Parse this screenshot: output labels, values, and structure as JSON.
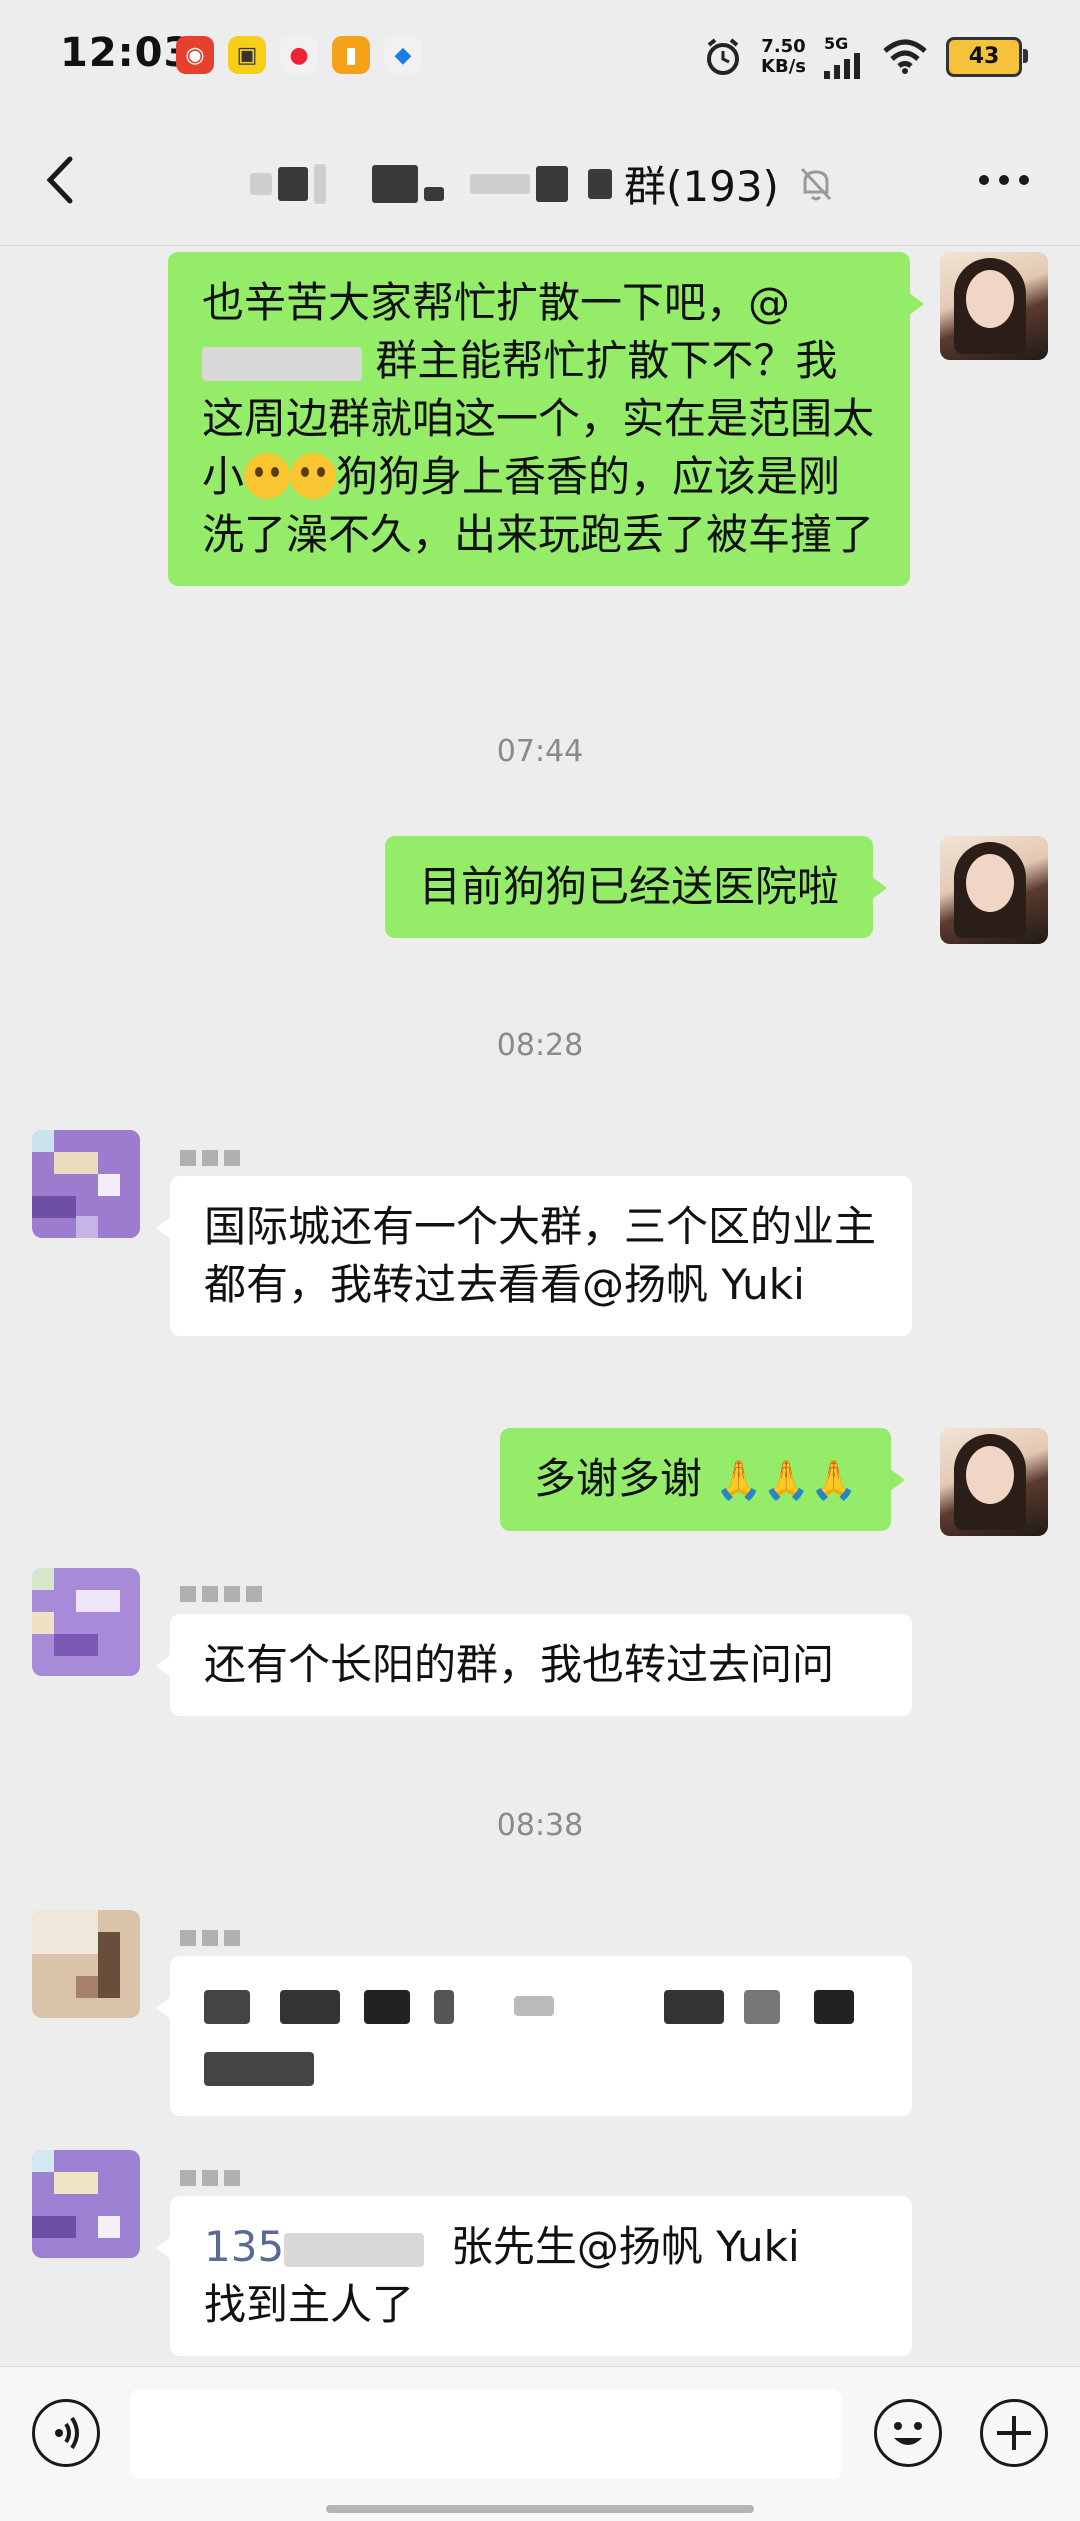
{
  "status_bar": {
    "time": "12:03",
    "net_speed_value": "7.50",
    "net_speed_unit": "KB/s",
    "signal_label": "5G",
    "battery": "43"
  },
  "header": {
    "title_suffix": "群(193)",
    "back_icon": "chevron-left-icon",
    "mute_icon": "bell-off-icon",
    "more_icon": "more-icon"
  },
  "messages": [
    {
      "side": "me",
      "text_a": "也辛苦大家帮忙扩散一下吧，@",
      "text_b": "群主能帮忙扩散下不？我这周边群就咱这一个，实在是范围太小",
      "text_c": "狗狗身上香香的，应该是刚洗了澡不久，出来玩跑丢了被车撞了"
    },
    {
      "timestamp": "07:44"
    },
    {
      "side": "me",
      "text": "目前狗狗已经送医院啦"
    },
    {
      "timestamp": "08:28"
    },
    {
      "side": "other",
      "text": "国际城还有一个大群，三个区的业主都有，我转过去看看@扬帆 Yuki"
    },
    {
      "side": "me",
      "text": "多谢多谢"
    },
    {
      "side": "other",
      "text": "还有个长阳的群，我也转过去问问"
    },
    {
      "timestamp": "08:38"
    },
    {
      "side": "other",
      "text": ""
    },
    {
      "side": "other",
      "phone_prefix": "135",
      "text_a": "张先生@扬帆 Yuki",
      "text_b": "找到主人了"
    }
  ],
  "input_bar": {
    "placeholder": "",
    "voice_icon": "voice-icon",
    "emoji_icon": "emoji-icon",
    "plus_icon": "plus-icon"
  },
  "colors": {
    "background": "#ededed",
    "bubble_me": "#95ec69",
    "bubble_other": "#ffffff"
  }
}
